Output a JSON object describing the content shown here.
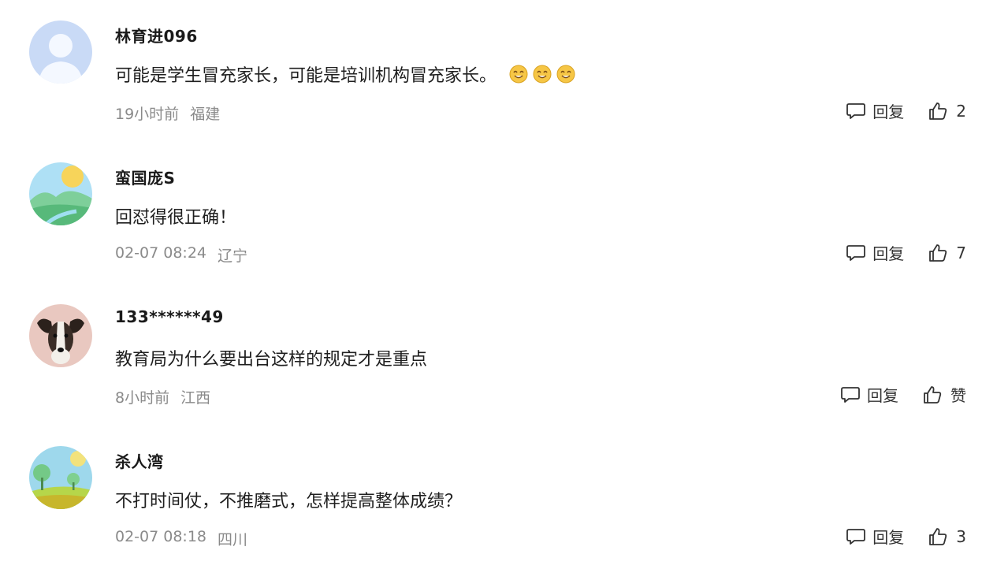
{
  "comments": [
    {
      "username": "林育进096",
      "text": "可能是学生冒充家长，可能是培训机构冒充家长。",
      "emojis": [
        "smile-emoji",
        "smile-emoji",
        "smile-emoji"
      ],
      "time": "19小时前",
      "location": "福建",
      "reply_label": "回复",
      "like_count": "2",
      "avatar": "default-person-avatar"
    },
    {
      "username": "蛮国庞S",
      "text": "回怼得很正确！",
      "time": "02-07 08:24",
      "location": "辽宁",
      "reply_label": "回复",
      "like_count": "7",
      "avatar": "landscape-sun-avatar"
    },
    {
      "username": "133******49",
      "text": "教育局为什么要出台这样的规定才是重点",
      "time": "8小时前",
      "location": "江西",
      "reply_label": "回复",
      "like_count": "赞",
      "avatar": "dog-photo-avatar"
    },
    {
      "username": "杀人湾",
      "text": "不打时间仗，不推磨式，怎样提高整体成绩？",
      "time": "02-07 08:18",
      "location": "四川",
      "reply_label": "回复",
      "like_count": "3",
      "avatar": "landscape-trees-avatar"
    }
  ],
  "colors": {
    "meta_gray": "#8a8a8a",
    "text_dark": "#1f1f1f",
    "emoji_yellow": "#f5c542"
  }
}
